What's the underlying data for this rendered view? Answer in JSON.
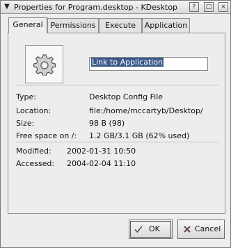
{
  "window": {
    "title": "Properties for Program.desktop - KDesktop",
    "help_icon": "?",
    "maximize_icon": "□",
    "close_icon": "×"
  },
  "tabs": [
    {
      "label": "General",
      "mnemonic": "G",
      "active": true
    },
    {
      "label": "Permissions",
      "mnemonic": "P",
      "active": false
    },
    {
      "label": "Execute",
      "mnemonic": "E",
      "active": false
    },
    {
      "label": "Application",
      "mnemonic": "A",
      "active": false
    }
  ],
  "general": {
    "icon": "gear-icon",
    "name_value": "Link to Application",
    "info": [
      {
        "label": "Type:",
        "value": "Desktop Config File"
      },
      {
        "label": "Location:",
        "value": "file:/home/mccartyb/Desktop/"
      },
      {
        "label": "Size:",
        "value": "98 B (98)"
      },
      {
        "label": "Free space on /:",
        "value": "1.2 GB/3.1 GB (62% used)"
      }
    ],
    "dates": [
      {
        "label": "Modified:",
        "value": "2002-01-31 10:50"
      },
      {
        "label": "Accessed:",
        "value": "2004-02-04 11:10"
      }
    ]
  },
  "buttons": {
    "ok_label": "OK",
    "cancel_label": "Cancel"
  }
}
